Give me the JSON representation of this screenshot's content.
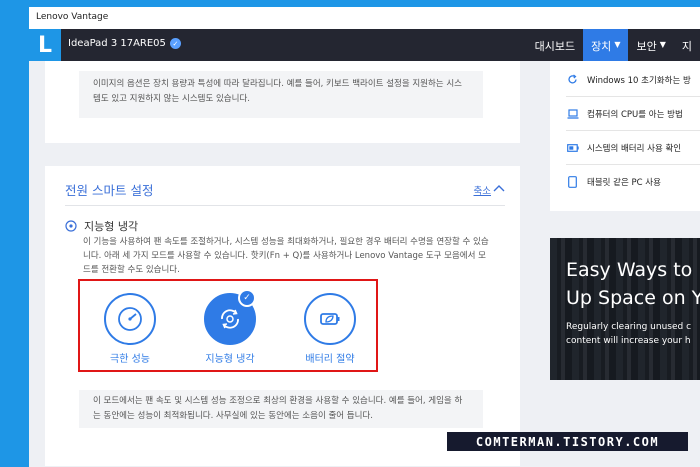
{
  "window": {
    "title": "Lenovo Vantage"
  },
  "appbar": {
    "logo": "L",
    "device_name": "IdeaPad 3 17ARE05",
    "nav": [
      {
        "label": "대시보드"
      },
      {
        "label": "장치"
      },
      {
        "label": "보안"
      },
      {
        "label": "지"
      }
    ]
  },
  "top_card": {
    "note": "이미지의 옵션은 장치 용량과 특성에 따라 달라집니다. 예를 들어, 키보드 백라이트 설정을 지원하는 시스템도 있고 지원하지 않는 시스템도 있습니다."
  },
  "power_card": {
    "title": "전원 스마트 설정",
    "collapse_label": "축소",
    "feature_title": "지능형 냉각",
    "feature_desc": "이 기능을 사용하여 팬 속도를 조절하거나, 시스템 성능을 최대화하거나, 필요한 경우 배터리 수명을 연장할 수 있습니다. 아래 세 가지 모드를 사용할 수 있습니다. 핫키(Fn + Q)를 사용하거나 Lenovo Vantage 도구 모음에서 모드를 전환할 수도 있습니다.",
    "modes": [
      {
        "label": "극한 성능",
        "selected": false
      },
      {
        "label": "지능형 냉각",
        "selected": true
      },
      {
        "label": "배터리 절약",
        "selected": false
      }
    ],
    "mode_note": "이 모드에서는 팬 속도 및 시스템 성능 조정으로 최상의 환경을 사용할 수 있습니다. 예를 들어, 게임을 하는 동안에는 성능이 최적화됩니다. 사무실에 있는 동안에는 소음이 줄어 듭니다."
  },
  "side_list": [
    {
      "label": "Windows 10 초기화하는 방",
      "icon": "refresh-icon"
    },
    {
      "label": "컴퓨터의 CPU를 아는 방법",
      "icon": "laptop-icon"
    },
    {
      "label": "시스템의 배터리 사용 확인",
      "icon": "battery-icon"
    },
    {
      "label": "태블릿 같은 PC 사용",
      "icon": "tablet-icon"
    }
  ],
  "promo": {
    "title": "Easy Ways to F\nUp Space on Y",
    "subtitle": "Regularly clearing unused c\ncontent will increase your h"
  },
  "watermark": "COMTERMAN.TISTORY.COM",
  "colors": {
    "accent": "#2f7be6",
    "highlight_box": "#e01616",
    "appbar": "#242631",
    "windows_blue": "#1e96e6"
  }
}
